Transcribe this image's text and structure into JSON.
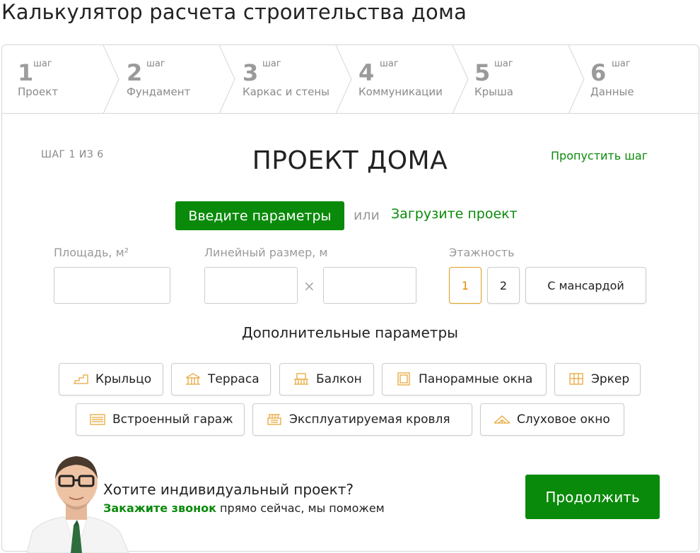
{
  "page": {
    "title": "Калькулятор расчета строительства дома"
  },
  "steps": [
    {
      "num": "1",
      "sup": "шаг",
      "label": "Проект"
    },
    {
      "num": "2",
      "sup": "шаг",
      "label": "Фундамент"
    },
    {
      "num": "3",
      "sup": "шаг",
      "label": "Каркас и стены"
    },
    {
      "num": "4",
      "sup": "шаг",
      "label": "Коммуникации"
    },
    {
      "num": "5",
      "sup": "шаг",
      "label": "Крыша"
    },
    {
      "num": "6",
      "sup": "шаг",
      "label": "Данные"
    }
  ],
  "form": {
    "step_counter": "ШАГ 1 ИЗ 6",
    "title": "ПРОЕКТ ДОМА",
    "skip": "Пропустить шаг",
    "enter_params": "Введите параметры",
    "or": "или",
    "upload": "Загрузите проект",
    "area_label": "Площадь, м²",
    "area_value": "",
    "linear_label": "Линейный размер, м",
    "linear_a": "",
    "times": "×",
    "linear_b": "",
    "floors_label": "Этажность",
    "floors": [
      "1",
      "2",
      "С мансардой"
    ],
    "floors_selected": "1"
  },
  "extra": {
    "title": "Дополнительные параметры",
    "chips": [
      {
        "label": "Крыльцо",
        "icon": "porch-icon"
      },
      {
        "label": "Терраса",
        "icon": "terrace-icon"
      },
      {
        "label": "Балкон",
        "icon": "balcony-icon"
      },
      {
        "label": "Панорамные окна",
        "icon": "panoramic-window-icon"
      },
      {
        "label": "Эркер",
        "icon": "bay-window-icon"
      },
      {
        "label": "Встроенный гараж",
        "icon": "garage-icon"
      },
      {
        "label": "Эксплуатируемая кровля",
        "icon": "roof-terrace-icon"
      },
      {
        "label": "Слуховое окно",
        "icon": "dormer-window-icon"
      }
    ]
  },
  "cta": {
    "question": "Хотите индивидуальный проект?",
    "call_link": "Закажите звонок",
    "rest": " прямо сейчас, мы поможем",
    "continue": "Продолжить"
  },
  "colors": {
    "accent": "#0a8a0a",
    "selected": "#e08a00",
    "icon": "#e8a73a"
  }
}
